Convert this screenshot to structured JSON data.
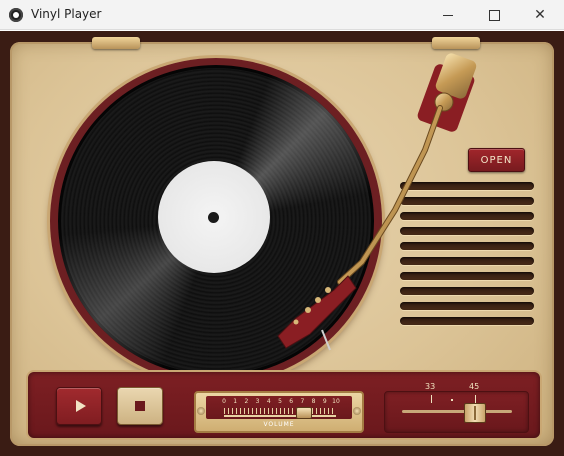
{
  "window": {
    "title": "Vinyl Player",
    "icons": {
      "app": "vinyl-record-icon",
      "minimize": "minimize-icon",
      "maximize": "maximize-icon",
      "close": "close-icon"
    }
  },
  "player": {
    "open_label": "OPEN",
    "controls": {
      "play_icon": "play-icon",
      "stop_icon": "stop-icon"
    },
    "volume": {
      "label": "VOLUME",
      "scale": [
        "0",
        "1",
        "2",
        "3",
        "4",
        "5",
        "6",
        "7",
        "8",
        "9",
        "10"
      ],
      "level": 7.1
    },
    "speed": {
      "options": [
        "33",
        "45"
      ],
      "selected": "45"
    }
  },
  "colors": {
    "case": "#3a1c14",
    "deck": "#dcc497",
    "accent_red": "#7d1f23",
    "brass": "#c9a773"
  }
}
